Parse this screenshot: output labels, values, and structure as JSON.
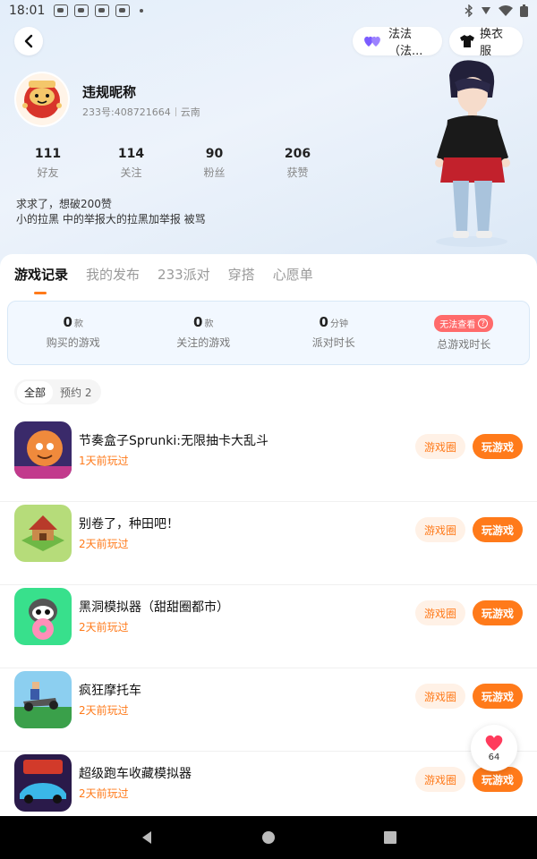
{
  "status_bar": {
    "time": "18:01"
  },
  "header": {
    "friend_pill_label": "法法（法...",
    "dress_pill_label": "换衣服"
  },
  "profile": {
    "nickname": "违规昵称",
    "uid": "233号:408721664",
    "location": "云南",
    "bio_line1": "求求了，想破200赞",
    "bio_line2": "小的拉黑 中的举报大的拉黑加举报 被骂"
  },
  "stats": [
    {
      "num": "111",
      "label": "好友"
    },
    {
      "num": "114",
      "label": "关注"
    },
    {
      "num": "90",
      "label": "粉丝"
    },
    {
      "num": "206",
      "label": "获赞"
    }
  ],
  "tabs": [
    "游戏记录",
    "我的发布",
    "233派对",
    "穿搭",
    "心愿单"
  ],
  "summary": {
    "bought": {
      "value": "0",
      "unit": "款",
      "label": "购买的游戏"
    },
    "followed": {
      "value": "0",
      "unit": "款",
      "label": "关注的游戏"
    },
    "party": {
      "value": "0",
      "unit": "分钟",
      "label": "派对时长"
    },
    "total": {
      "badge": "无法查看",
      "label": "总游戏时长"
    }
  },
  "filters": {
    "all": "全部",
    "reserved": "预约 2"
  },
  "games": [
    {
      "name": "节奏盒子Sprunki:无限抽卡大乱斗",
      "time": "1天前玩过"
    },
    {
      "name": "别卷了，种田吧！",
      "time": "2天前玩过"
    },
    {
      "name": "黑洞模拟器（甜甜圈都市）",
      "time": "2天前玩过"
    },
    {
      "name": "疯狂摩托车",
      "time": "2天前玩过"
    },
    {
      "name": "超级跑车收藏模拟器",
      "time": "2天前玩过"
    }
  ],
  "row_buttons": {
    "circle": "游戏圈",
    "play": "玩游戏"
  },
  "like_float": {
    "count": "64"
  },
  "colors": {
    "accent": "#ff7a1a",
    "badge": "#ff6b6b"
  }
}
